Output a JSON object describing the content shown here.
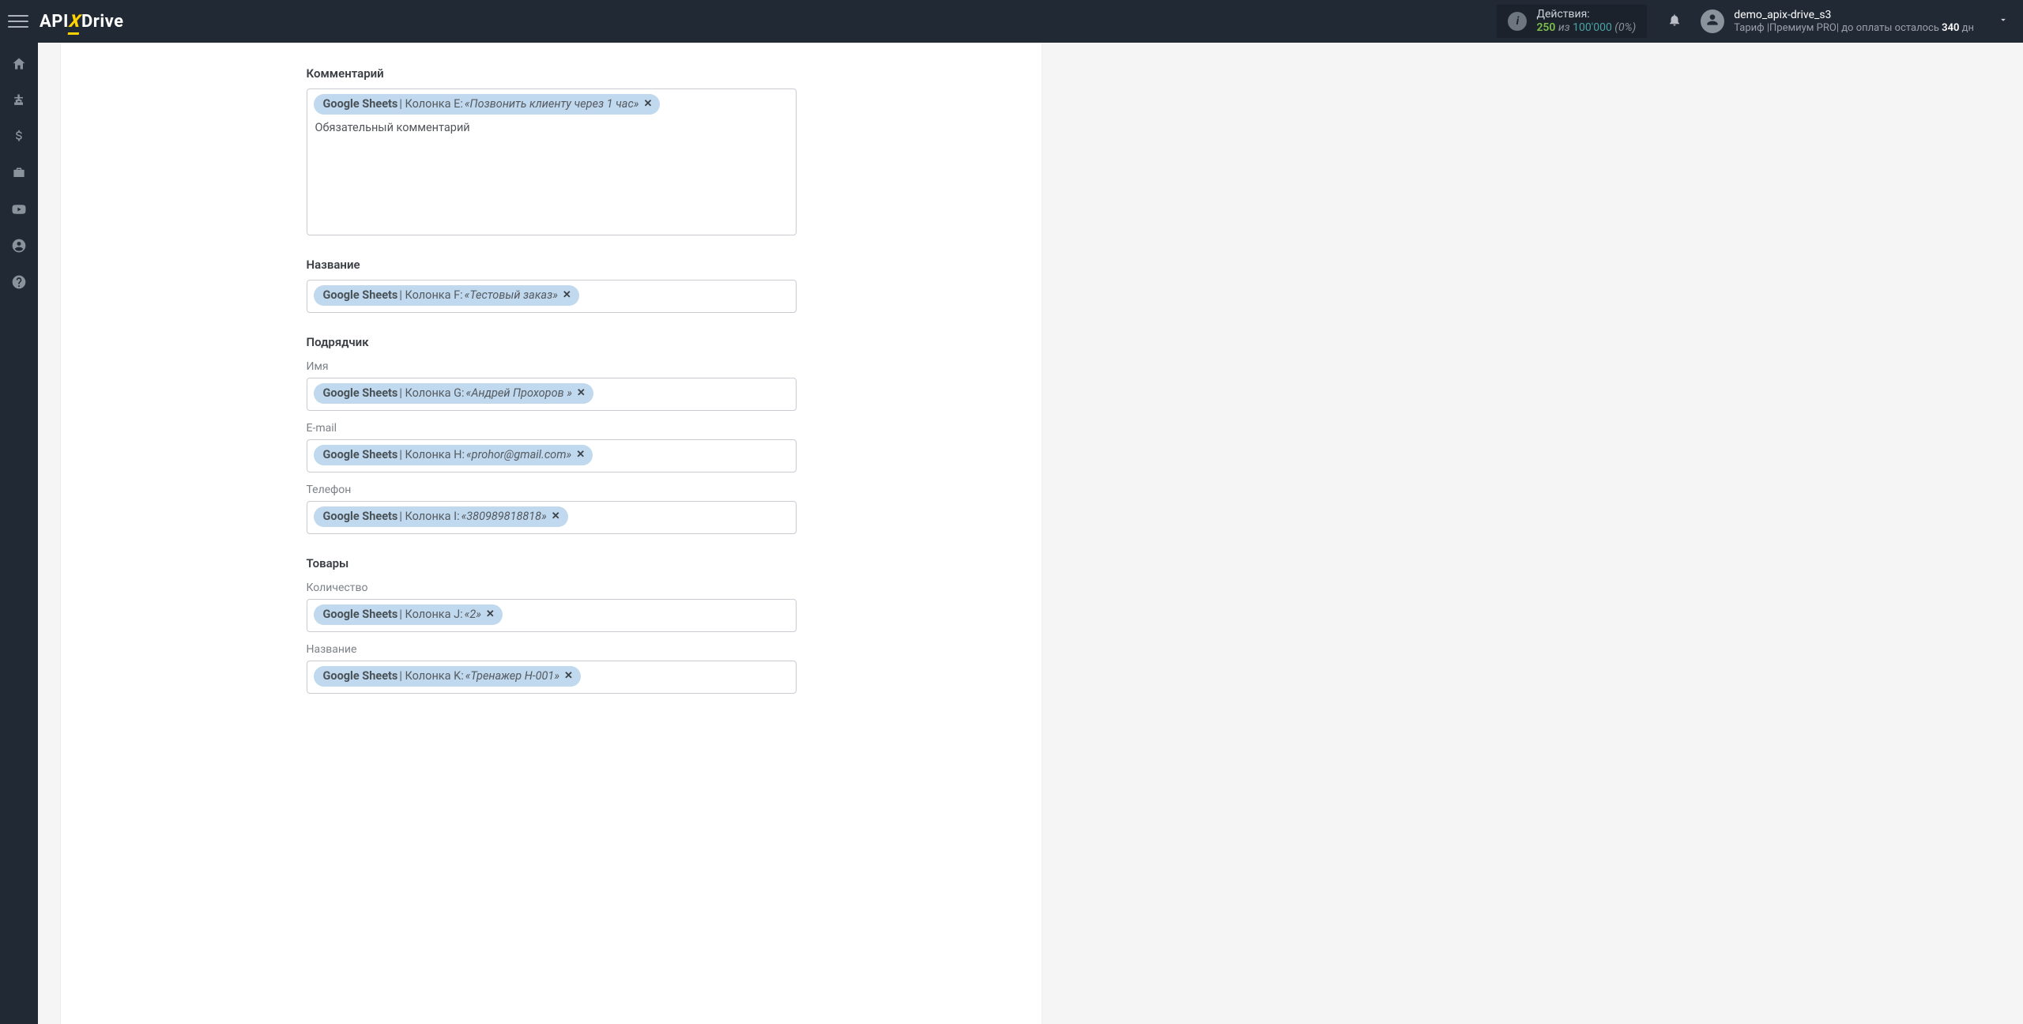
{
  "header": {
    "logo": {
      "part1": "API",
      "partX": "X",
      "part2": "Drive"
    },
    "actions": {
      "title": "Действия:",
      "used": "250",
      "sep": "из",
      "total": "100'000",
      "pct": "(0%)"
    },
    "user": {
      "name": "demo_apix-drive_s3",
      "plan_prefix": "Тариф |",
      "plan_name": "Премиум PRO",
      "plan_mid": "|  до оплаты осталось ",
      "plan_days": "340",
      "plan_suffix": " дн"
    }
  },
  "form": {
    "comment": {
      "label": "Комментарий",
      "chip": {
        "source": "Google Sheets",
        "column": " | Колонка E: ",
        "value": "«Позвонить клиенту через 1 час»"
      },
      "freetext": "Обязательный комментарий"
    },
    "title_field": {
      "label": "Название",
      "chip": {
        "source": "Google Sheets",
        "column": " | Колонка F: ",
        "value": "«Тестовый заказ»"
      }
    },
    "contractor": {
      "label": "Подрядчик",
      "name": {
        "sublabel": "Имя",
        "chip": {
          "source": "Google Sheets",
          "column": " | Колонка G: ",
          "value": "«Андрей Прохоров »"
        }
      },
      "email": {
        "sublabel": "E-mail",
        "chip": {
          "source": "Google Sheets",
          "column": " | Колонка H: ",
          "value": "«prohor@gmail.com»"
        }
      },
      "phone": {
        "sublabel": "Телефон",
        "chip": {
          "source": "Google Sheets",
          "column": " | Колонка I: ",
          "value": "«380989818818»"
        }
      }
    },
    "products": {
      "label": "Товары",
      "qty": {
        "sublabel": "Количество",
        "chip": {
          "source": "Google Sheets",
          "column": " | Колонка J: ",
          "value": "«2»"
        }
      },
      "name": {
        "sublabel": "Название",
        "chip": {
          "source": "Google Sheets",
          "column": " | Колонка K: ",
          "value": "«Тренажер H-001»"
        }
      }
    }
  }
}
